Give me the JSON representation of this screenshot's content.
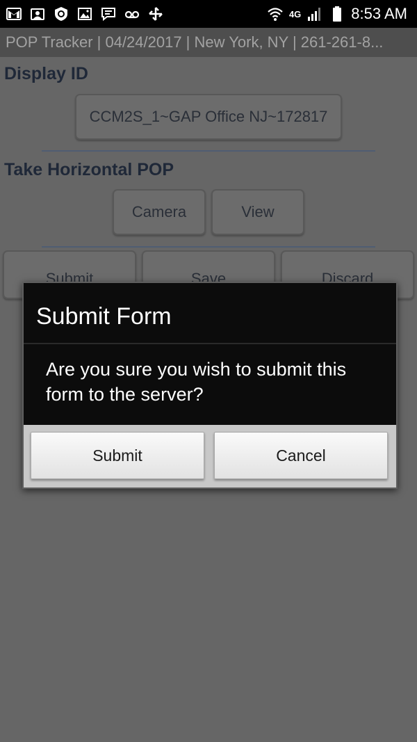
{
  "status_bar": {
    "time": "8:53 AM",
    "network": "4G",
    "left_icons": [
      "gmail-icon",
      "mail-icon",
      "alert-icon",
      "image-icon",
      "message-icon",
      "voicemail-icon",
      "sync-icon"
    ],
    "right_icons": [
      "wifi-icon",
      "signal-icon",
      "battery-icon"
    ]
  },
  "app": {
    "title": "POP Tracker | 04/24/2017 | New York, NY | 261-261-8...",
    "display_id": {
      "label": "Display ID",
      "value": "CCM2S_1~GAP Office NJ~172817"
    },
    "horizontal_pop": {
      "label": "Take Horizontal POP",
      "camera_label": "Camera",
      "view_label": "View"
    },
    "actions": {
      "submit_label": "Submit",
      "save_label": "Save",
      "discard_label": "Discard"
    }
  },
  "dialog": {
    "title": "Submit Form",
    "message": "Are you sure you wish to submit this form to the server?",
    "submit_label": "Submit",
    "cancel_label": "Cancel"
  },
  "colors": {
    "overlay": "#666666",
    "dialog_header": "#0c0c0c",
    "dialog_action_bar": "#c8c8c8",
    "section_label": "#1f2838"
  }
}
